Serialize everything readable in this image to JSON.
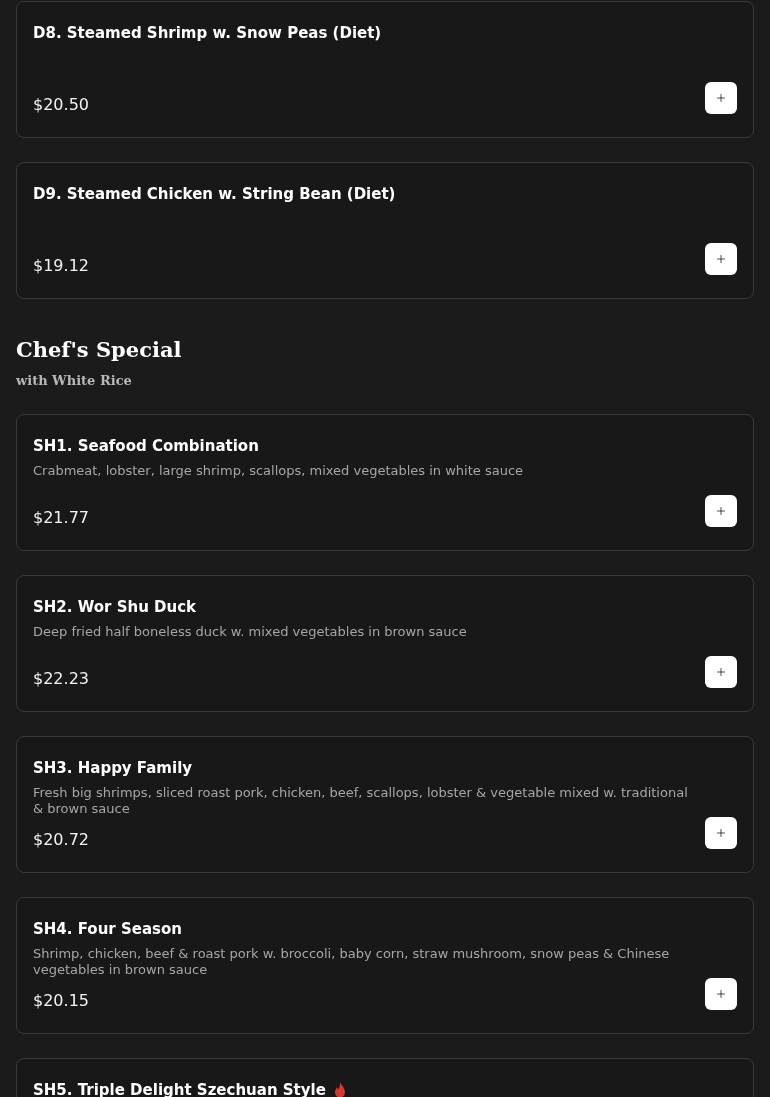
{
  "sections": [
    {
      "items": [
        {
          "name": "D8. Steamed Shrimp w. Snow Peas (Diet)",
          "price": "$20.50",
          "spicy": false
        },
        {
          "name": "D9. Steamed Chicken w. String Bean (Diet)",
          "price": "$19.12",
          "spicy": false
        }
      ]
    },
    {
      "title": "Chef's Special",
      "subtitle": "with White Rice",
      "items": [
        {
          "name": "SH1. Seafood Combination",
          "description": "Crabmeat, lobster, large shrimp, scallops, mixed vegetables in white sauce",
          "price": "$21.77",
          "spicy": false
        },
        {
          "name": "SH2. Wor Shu Duck",
          "description": "Deep fried half boneless duck w. mixed vegetables in brown sauce",
          "price": "$22.23",
          "spicy": false
        },
        {
          "name": "SH3. Happy Family",
          "description": "Fresh big shrimps, sliced roast pork, chicken, beef, scallops, lobster & vegetable mixed w. traditional & brown sauce",
          "price": "$20.72",
          "spicy": false
        },
        {
          "name": "SH4. Four Season",
          "description": "Shrimp, chicken, beef & roast pork w. broccoli, baby corn, straw mushroom, snow peas & Chinese vegetables in brown sauce",
          "price": "$20.15",
          "spicy": false
        },
        {
          "name": "SH5. Triple Delight Szechuan Style",
          "spicy": true
        }
      ]
    }
  ]
}
